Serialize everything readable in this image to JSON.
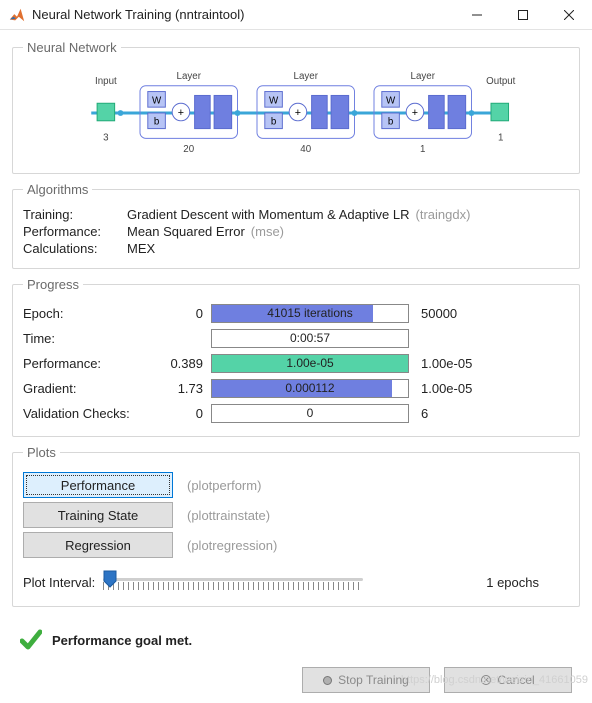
{
  "window": {
    "title": "Neural Network Training (nntraintool)"
  },
  "sections": {
    "nn": {
      "legend": "Neural Network",
      "nodes": {
        "input_label": "Input",
        "input_size": "3",
        "layer_label": "Layer",
        "l1_size": "20",
        "l2_size": "40",
        "l3_size": "1",
        "output_label": "Output",
        "output_size": "1",
        "w": "W",
        "b": "b",
        "plus": "+"
      }
    },
    "algo": {
      "legend": "Algorithms",
      "rows": [
        {
          "label": "Training:",
          "value": "Gradient Descent with Momentum & Adaptive LR",
          "code": "(traingdx)"
        },
        {
          "label": "Performance:",
          "value": "Mean Squared Error",
          "code": "(mse)"
        },
        {
          "label": "Calculations:",
          "value": "MEX",
          "code": ""
        }
      ]
    },
    "progress": {
      "legend": "Progress",
      "rows": [
        {
          "label": "Epoch:",
          "start": "0",
          "bar_text": "41015 iterations",
          "fill_pct": 82,
          "fill_color": "#6f7fe0",
          "end": "50000"
        },
        {
          "label": "Time:",
          "start": "",
          "bar_text": "0:00:57",
          "fill_pct": 0,
          "fill_color": "#6f7fe0",
          "end": ""
        },
        {
          "label": "Performance:",
          "start": "0.389",
          "bar_text": "1.00e-05",
          "fill_pct": 100,
          "fill_color": "#54d3a7",
          "end": "1.00e-05"
        },
        {
          "label": "Gradient:",
          "start": "1.73",
          "bar_text": "0.000112",
          "fill_pct": 92,
          "fill_color": "#6f7fe0",
          "end": "1.00e-05"
        },
        {
          "label": "Validation Checks:",
          "start": "0",
          "bar_text": "0",
          "fill_pct": 0,
          "fill_color": "#6f7fe0",
          "end": "6"
        }
      ]
    },
    "plots": {
      "legend": "Plots",
      "buttons": [
        {
          "label": "Performance",
          "code": "(plotperform)",
          "focus": true
        },
        {
          "label": "Training State",
          "code": "(plottrainstate)",
          "focus": false
        },
        {
          "label": "Regression",
          "code": "(plotregression)",
          "focus": false
        }
      ],
      "interval_label": "Plot Interval:",
      "interval_value": "1 epochs"
    }
  },
  "status": {
    "message": "Performance goal met."
  },
  "actions": {
    "stop": "Stop Training",
    "cancel": "Cancel"
  },
  "watermark": "https://blog.csdn.net/weixin_41661059"
}
